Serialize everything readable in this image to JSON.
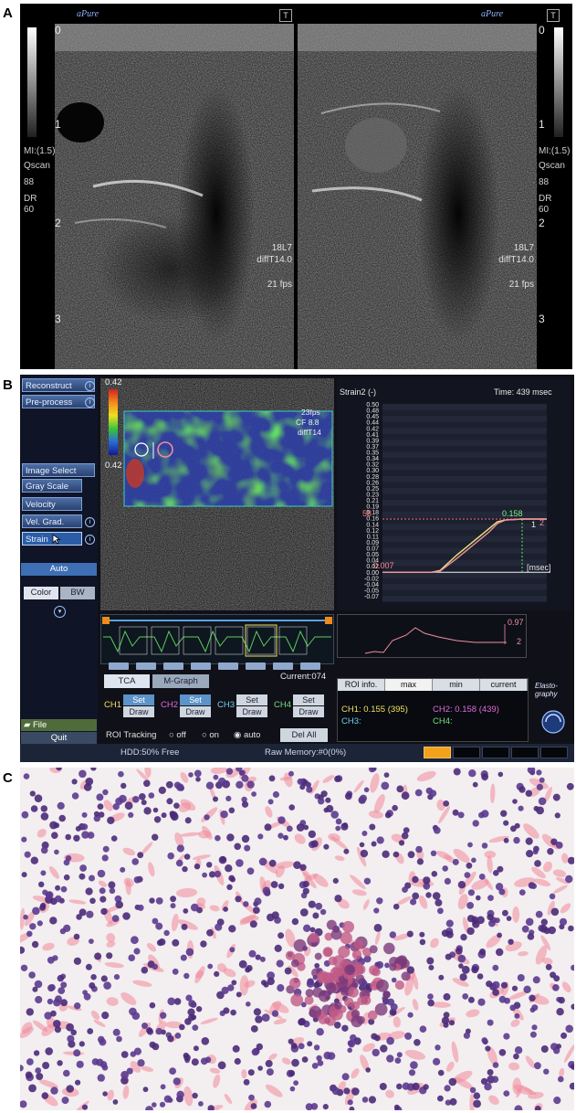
{
  "panel_labels": {
    "a": "A",
    "b": "B",
    "c": "C"
  },
  "panel_a": {
    "left": {
      "depth_marks": [
        "0",
        "1",
        "2",
        "3"
      ],
      "mi": "MI:(1.5)",
      "qscan": "Qscan",
      "qscan_value": "88",
      "dr": "DR",
      "dr_value": "60",
      "probe": "18L7",
      "preset": "diffT14.0",
      "fps": "21 fps"
    },
    "right": {
      "depth_marks": [
        "0",
        "1",
        "2",
        "3"
      ],
      "mi": "MI:(1.5)",
      "qscan": "Qscan",
      "qscan_value": "88",
      "dr": "DR",
      "dr_value": "60",
      "probe": "18L7",
      "preset": "diffT14.0",
      "fps": "21 fps"
    },
    "logo_text": "aPure",
    "badge": "T"
  },
  "panel_b": {
    "sidebar": {
      "reconstruct": "Reconstruct",
      "preprocess": "Pre-process",
      "image_select": "Image Select",
      "gray_scale": "Gray Scale",
      "velocity": "Velocity",
      "vel_grad": "Vel. Grad.",
      "strain": "Strain",
      "auto": "Auto",
      "color": "Color",
      "bw": "BW",
      "file": "File",
      "quit": "Quit"
    },
    "colorbar": {
      "top": "0.42",
      "bottom": "0.42"
    },
    "image_overlay": {
      "fps": "23fps",
      "cf": "CF 8.8",
      "preset": "diffT14"
    },
    "graph": {
      "title": "Strain2 (-)",
      "time": "Time: 439 msec",
      "unit": "[msec]",
      "start_label": "0.007",
      "marker_left": "58",
      "marker_right": "0.158",
      "series_labels": [
        "1",
        "2"
      ]
    },
    "chart_data": {
      "type": "line",
      "title": "Strain2 (-)",
      "xlabel": "[msec]",
      "ylabel": "",
      "yticks": [
        "0.50",
        "0.48",
        "0.45",
        "0.44",
        "0.42",
        "0.41",
        "0.39",
        "0.37",
        "0.35",
        "0.34",
        "0.32",
        "0.30",
        "0.28",
        "0.26",
        "0.25",
        "0.23",
        "0.21",
        "0.19",
        "0.18",
        "0.16",
        "0.14",
        "0.12",
        "0.11",
        "0.09",
        "0.07",
        "0.05",
        "0.04",
        "0.02",
        "0.00",
        "-0.02",
        "-0.04",
        "-0.05",
        "-0.07"
      ],
      "ylim": [
        -0.07,
        0.5
      ],
      "xlim": [
        0,
        1
      ],
      "series": [
        {
          "name": "1",
          "color": "#f0e47a",
          "x": [
            0.0,
            0.2,
            0.3,
            0.35,
            0.45,
            0.55,
            0.65,
            0.7,
            0.75,
            0.85,
            1.0
          ],
          "y": [
            0.0,
            0.0,
            0.0,
            0.005,
            0.05,
            0.09,
            0.13,
            0.15,
            0.155,
            0.158,
            0.158
          ]
        },
        {
          "name": "2",
          "color": "#ef8f9c",
          "x": [
            0.0,
            0.2,
            0.3,
            0.35,
            0.45,
            0.55,
            0.65,
            0.7,
            0.75,
            0.85,
            1.0
          ],
          "y": [
            0.0,
            0.0,
            0.0,
            0.003,
            0.04,
            0.08,
            0.12,
            0.145,
            0.155,
            0.158,
            0.158
          ]
        }
      ]
    },
    "small_graph": {
      "value": "0.97",
      "label": "2"
    },
    "current": "Current:074",
    "tabs": {
      "tca": "TCA",
      "mgraph": "M-Graph"
    },
    "channels": [
      {
        "name": "CH1",
        "color": "#f0e060",
        "set": "Set",
        "draw": "Draw"
      },
      {
        "name": "CH2",
        "color": "#e06ad8",
        "set": "Set",
        "draw": "Draw"
      },
      {
        "name": "CH3",
        "color": "#6fd0e8",
        "set": "Set",
        "draw": "Draw"
      },
      {
        "name": "CH4",
        "color": "#6fe07a",
        "set": "Set",
        "draw": "Draw"
      }
    ],
    "roi_tracking": {
      "label": "ROI Tracking",
      "off": "off",
      "on": "on",
      "auto": "auto",
      "del_all": "Del All"
    },
    "info_tabs": {
      "roi_info": "ROI info.",
      "max": "max",
      "min": "min",
      "current": "current"
    },
    "info_values": {
      "ch1": "CH1: 0.155 (395)",
      "ch2": "CH2: 0.158 (439)",
      "ch3": "CH3:",
      "ch4": "CH4:"
    },
    "elasto_logo": "Elasto- graphy",
    "status": {
      "hdd": "HDD:50% Free",
      "raw_memory": "Raw Memory:#0(0%)"
    }
  }
}
